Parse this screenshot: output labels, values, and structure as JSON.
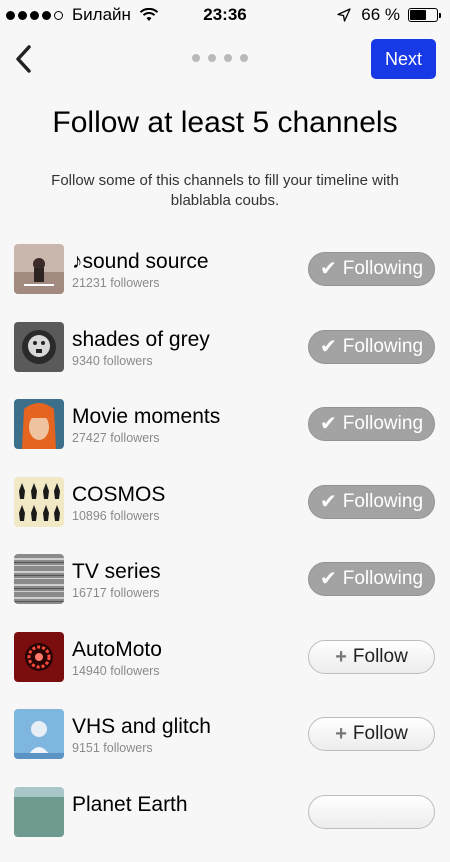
{
  "status_bar": {
    "carrier": "Билайн",
    "time": "23:36",
    "battery": "66 %",
    "battery_level": 0.66
  },
  "nav": {
    "next_label": "Next",
    "page_count": 4
  },
  "title": "Follow at least 5 channels",
  "subtitle": "Follow some of this channels to fill your timeline with blablabla coubs.",
  "channels": [
    {
      "name": "♪sound source",
      "followers": "21231 followers",
      "button_label": "Following",
      "button_icon": "✔",
      "state": "following"
    },
    {
      "name": "shades of grey",
      "followers": "9340 followers",
      "button_label": "Following",
      "button_icon": "✔",
      "state": "following"
    },
    {
      "name": "Movie moments",
      "followers": "27427 followers",
      "button_label": "Following",
      "button_icon": "✔",
      "state": "following"
    },
    {
      "name": "COSMOS",
      "followers": "10896 followers",
      "button_label": "Following",
      "button_icon": "✔",
      "state": "following"
    },
    {
      "name": "TV series",
      "followers": "16717 followers",
      "button_label": "Following",
      "button_icon": "✔",
      "state": "following"
    },
    {
      "name": "AutoMoto",
      "followers": "14940 followers",
      "button_label": "Follow",
      "button_icon": "+",
      "state": "follow"
    },
    {
      "name": "VHS and glitch",
      "followers": "9151 followers",
      "button_label": "Follow",
      "button_icon": "+",
      "state": "follow"
    },
    {
      "name": "Planet Earth",
      "followers": "",
      "button_label": "",
      "button_icon": "",
      "state": "follow"
    }
  ],
  "colors": {
    "accent": "#1739e6",
    "following_bg": "#a3a3a3",
    "background": "#f7f7f7"
  }
}
